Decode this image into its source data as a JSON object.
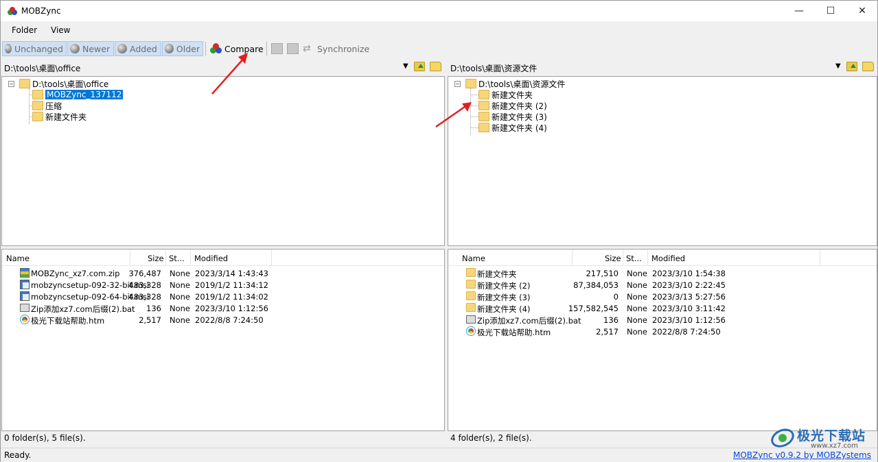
{
  "window": {
    "title": "MOBZync",
    "minimize": "—",
    "maximize": "☐",
    "close": "✕"
  },
  "menu": {
    "items": [
      "Folder",
      "View"
    ]
  },
  "toolbar": {
    "unchanged": "Unchanged",
    "newer": "Newer",
    "added": "Added",
    "older": "Older",
    "compare": "Compare",
    "synchronize": "Synchronize"
  },
  "left": {
    "path": "D:\\tools\\桌面\\office",
    "tree": {
      "root": "D:\\tools\\桌面\\office",
      "children": [
        "MOBZync_137112",
        "压缩",
        "新建文件夹"
      ],
      "selected_index": 0
    },
    "list": {
      "columns": [
        "Name",
        "Size",
        "St...",
        "Modified"
      ],
      "rows": [
        {
          "icon": "zip-icon",
          "name": "MOBZync_xz7.com.zip",
          "size": "376,487",
          "status": "None",
          "modified": "2023/3/14 1:43:43"
        },
        {
          "icon": "msi-icon",
          "name": "mobzyncsetup-092-32-bit.msi",
          "size": "483,328",
          "status": "None",
          "modified": "2019/1/2 11:34:12"
        },
        {
          "icon": "msi-icon",
          "name": "mobzyncsetup-092-64-bit.msi",
          "size": "483,328",
          "status": "None",
          "modified": "2019/1/2 11:34:02"
        },
        {
          "icon": "bat-icon",
          "name": "Zip添加xz7.com后缀(2).bat",
          "size": "136",
          "status": "None",
          "modified": "2023/3/10 1:12:56"
        },
        {
          "icon": "htm-icon",
          "name": "极光下载站帮助.htm",
          "size": "2,517",
          "status": "None",
          "modified": "2022/8/8 7:24:50"
        }
      ]
    },
    "status": "0 folder(s), 5 file(s)."
  },
  "right": {
    "path": "D:\\tools\\桌面\\资源文件",
    "tree": {
      "root": "D:\\tools\\桌面\\资源文件",
      "children": [
        "新建文件夹",
        "新建文件夹 (2)",
        "新建文件夹 (3)",
        "新建文件夹 (4)"
      ]
    },
    "list": {
      "columns": [
        "Name",
        "Size",
        "St...",
        "Modified"
      ],
      "rows": [
        {
          "icon": "folder-icon",
          "name": "新建文件夹",
          "size": "217,510",
          "status": "None",
          "modified": "2023/3/10 1:54:38"
        },
        {
          "icon": "folder-icon",
          "name": "新建文件夹 (2)",
          "size": "87,384,053",
          "status": "None",
          "modified": "2023/3/10 2:22:45"
        },
        {
          "icon": "folder-icon",
          "name": "新建文件夹 (3)",
          "size": "0",
          "status": "None",
          "modified": "2023/3/13 5:27:56"
        },
        {
          "icon": "folder-icon",
          "name": "新建文件夹 (4)",
          "size": "157,582,545",
          "status": "None",
          "modified": "2023/3/10 3:11:42"
        },
        {
          "icon": "bat-icon",
          "name": "Zip添加xz7.com后缀(2).bat",
          "size": "136",
          "status": "None",
          "modified": "2023/3/10 1:12:56"
        },
        {
          "icon": "htm-icon",
          "name": "极光下载站帮助.htm",
          "size": "2,517",
          "status": "None",
          "modified": "2022/8/8 7:24:50"
        }
      ]
    },
    "status": "4 folder(s), 2 file(s)."
  },
  "statusbar": {
    "text": "Ready.",
    "link": "MOBZync v0.9.2 by MOBZystems"
  },
  "watermark": {
    "text": "极光下载站",
    "sub": "www.xz7.com"
  },
  "colors": {
    "selection": "#0078d7",
    "link": "#0645d8",
    "arrow": "#e02020"
  }
}
